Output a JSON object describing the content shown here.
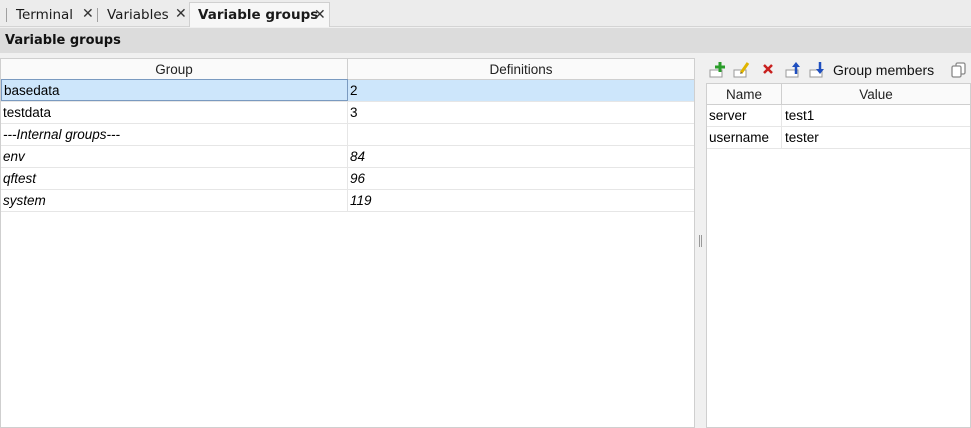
{
  "tabs": [
    {
      "label": "Terminal",
      "active": false
    },
    {
      "label": "Variables",
      "active": false
    },
    {
      "label": "Variable groups",
      "active": true
    }
  ],
  "close_glyph": "✕",
  "panel_title": "Variable groups",
  "groups_table": {
    "columns": [
      "Group",
      "Definitions"
    ],
    "rows": [
      {
        "group": "basedata",
        "definitions": "2",
        "italic": false,
        "selected": true
      },
      {
        "group": "testdata",
        "definitions": "3",
        "italic": false,
        "selected": false
      },
      {
        "group": "---Internal groups---",
        "definitions": "",
        "italic": true,
        "selected": false
      },
      {
        "group": "env",
        "definitions": "84",
        "italic": true,
        "selected": false
      },
      {
        "group": "qftest",
        "definitions": "96",
        "italic": true,
        "selected": false
      },
      {
        "group": "system",
        "definitions": "119",
        "italic": true,
        "selected": false
      }
    ]
  },
  "members_toolbar": {
    "label": "Group members",
    "buttons": [
      "add-icon",
      "edit-icon",
      "delete-icon",
      "move-up-icon",
      "move-down-icon"
    ],
    "copy_icon": "copy-icon"
  },
  "members_table": {
    "columns": [
      "Name",
      "Value"
    ],
    "rows": [
      {
        "name": "server",
        "value": "test1"
      },
      {
        "name": "username",
        "value": "tester"
      }
    ]
  },
  "colors": {
    "selection": "#cde6fb",
    "add_green": "#2a9d2a",
    "edit_yellow": "#e0b400",
    "delete_red": "#c8201e",
    "arrow_blue": "#1f4fbf"
  }
}
